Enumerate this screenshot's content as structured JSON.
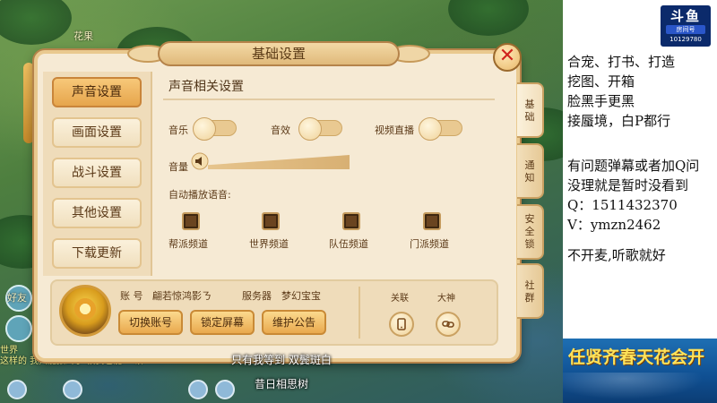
{
  "background": {
    "top_label": "花果",
    "left_label": "好友"
  },
  "dialog": {
    "title": "基础设置",
    "close_glyph": "✕",
    "sidebar": [
      {
        "label": "声音设置",
        "active": true
      },
      {
        "label": "画面设置",
        "active": false
      },
      {
        "label": "战斗设置",
        "active": false
      },
      {
        "label": "其他设置",
        "active": false
      },
      {
        "label": "下载更新",
        "active": false
      }
    ],
    "section_title": "声音相关设置",
    "toggles": [
      {
        "label": "音乐"
      },
      {
        "label": "音效"
      },
      {
        "label": "视频直播"
      }
    ],
    "volume_label": "音量",
    "auto_play_label": "自动播放语音:",
    "channels": [
      {
        "label": "帮派频道"
      },
      {
        "label": "世界频道"
      },
      {
        "label": "队伍频道"
      },
      {
        "label": "门派频道"
      }
    ],
    "right_tabs": [
      {
        "label": "基础",
        "active": true
      },
      {
        "label": "通知",
        "active": false
      },
      {
        "label": "安全锁",
        "active": false
      },
      {
        "label": "社群",
        "active": false
      }
    ],
    "account": {
      "account_label": "账 号",
      "account_value": "翩若惊鸿影ㄋ",
      "server_label": "服务器",
      "server_value": "梦幻宝宝"
    },
    "actions": [
      {
        "label": "切换账号"
      },
      {
        "label": "锁定屏幕"
      },
      {
        "label": "维护公告"
      }
    ],
    "mini": [
      {
        "label": "关联",
        "icon": "phone-icon"
      },
      {
        "label": "大神",
        "icon": "link-icon"
      }
    ]
  },
  "subtitles": {
    "line1": "只有我等到 双鬓斑白",
    "line2": "昔日相思树"
  },
  "chat": {
    "line1": "世界",
    "line2": "这样的 我只能报到了 被我也能一 顿"
  },
  "stream": {
    "logo": "斗鱼",
    "room_label": "房间号",
    "room_id": "10129780",
    "notes": [
      "合宠、打书、打造",
      "挖图、开箱",
      "脸黑手更黑",
      "接蜃境，白P都行",
      "",
      "有问题弹幕或者加Q问",
      "没理就是暂时没看到",
      "Q：1511432370",
      "V：ymzn2462",
      "",
      "不开麦,听歌就好"
    ],
    "banner": "任贤齐春天花会开"
  }
}
